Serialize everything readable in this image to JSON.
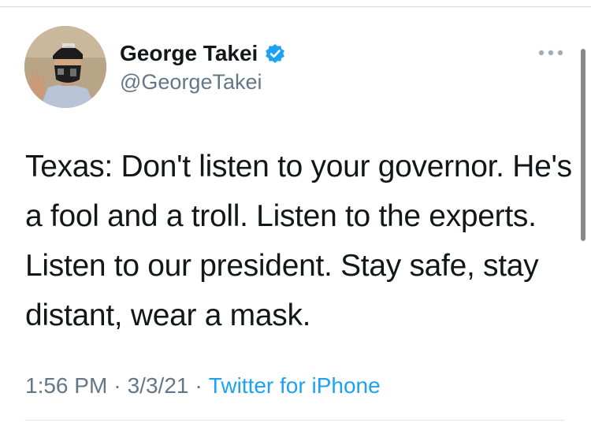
{
  "tweet": {
    "display_name": "George Takei",
    "handle": "@GeorgeTakei",
    "verified": true,
    "text": "Texas: Don't listen to your governor. He's a fool and a troll. Listen to the experts. Listen to our president. Stay safe, stay distant, wear a mask.",
    "time": "1:56 PM",
    "date": "3/3/21",
    "separator": "·",
    "source": "Twitter for iPhone"
  },
  "icons": {
    "verified": "verified-badge-icon",
    "more": "more-options-icon"
  },
  "colors": {
    "text": "#14171a",
    "secondary": "#657786",
    "link": "#1da1f2",
    "verified": "#1da1f2"
  }
}
